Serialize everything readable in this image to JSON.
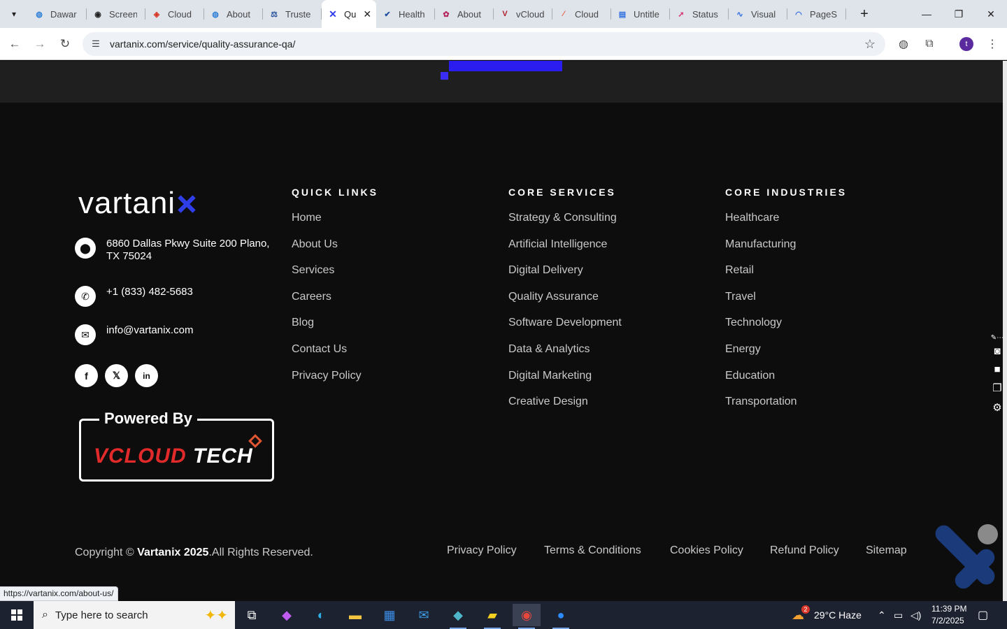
{
  "browser": {
    "tabs": [
      {
        "title": "Dawar",
        "icon": "globe-icon",
        "color": "#2f7fd6"
      },
      {
        "title": "Screen",
        "icon": "camera-icon",
        "color": "#222222"
      },
      {
        "title": "Cloud",
        "icon": "cloud-icon",
        "color": "#d93b2b"
      },
      {
        "title": "About",
        "icon": "globe-icon",
        "color": "#2f7fd6"
      },
      {
        "title": "Truste",
        "icon": "scale-icon",
        "color": "#1f4e9c"
      },
      {
        "title": "Qu",
        "icon": "vartanix-icon",
        "color": "#2e3ee8",
        "active": true
      },
      {
        "title": "Health",
        "icon": "check-icon",
        "color": "#1f4e9c"
      },
      {
        "title": "About",
        "icon": "flower-icon",
        "color": "#b4255a"
      },
      {
        "title": "vCloud",
        "icon": "v-icon",
        "color": "#b01e2e"
      },
      {
        "title": "Cloud",
        "icon": "slash-icon",
        "color": "#e25533"
      },
      {
        "title": "Untitle",
        "icon": "doc-icon",
        "color": "#2f6fe0"
      },
      {
        "title": "Status",
        "icon": "status-icon",
        "color": "#d93b7a"
      },
      {
        "title": "Visual",
        "icon": "wave-icon",
        "color": "#2d6be0"
      },
      {
        "title": "PageS",
        "icon": "gauge-icon",
        "color": "#2d6be0"
      }
    ],
    "url": "vartanix.com/service/quality-assurance-qa/",
    "profile_initial": "t",
    "status_url": "https://vartanix.com/about-us/"
  },
  "footer": {
    "logo_text": "vartani",
    "contact": {
      "address": "6860 Dallas Pkwy Suite 200 Plano, TX 75024",
      "phone": "+1 (833) 482-5683",
      "email": "info@vartanix.com"
    },
    "social": [
      "f",
      "𝕏",
      "in"
    ],
    "powered_by": {
      "label": "Powered By",
      "brand_red": "VCLOUD",
      "brand_white": " TECH"
    },
    "columns": [
      {
        "heading": "QUICK LINKS",
        "links": [
          "Home",
          "About Us",
          "Services",
          "Careers",
          "Blog",
          "Contact Us",
          "Privacy Policy"
        ]
      },
      {
        "heading": "CORE SERVICES",
        "links": [
          "Strategy & Consulting",
          "Artificial Intelligence",
          "Digital Delivery",
          "Quality Assurance",
          "Software Development",
          "Data & Analytics",
          "Digital Marketing",
          "Creative Design"
        ]
      },
      {
        "heading": "CORE INDUSTRIES",
        "links": [
          "Healthcare",
          "Manufacturing",
          "Retail",
          "Travel",
          "Technology",
          "Energy",
          "Education",
          "Transportation"
        ]
      }
    ],
    "copyright_prefix": "Copyright © ",
    "copyright_brand": "Vartanix 2025",
    "copyright_suffix": ".All Rights Reserved.",
    "bottom_links": [
      "Privacy Policy",
      "Terms & Conditions",
      "Cookies Policy",
      "Refund Policy",
      "Sitemap"
    ]
  },
  "taskbar": {
    "search_placeholder": "Type here to search",
    "weather_badge": "2",
    "weather": "29°C  Haze",
    "time": "11:39 PM",
    "date": "7/2/2025"
  }
}
